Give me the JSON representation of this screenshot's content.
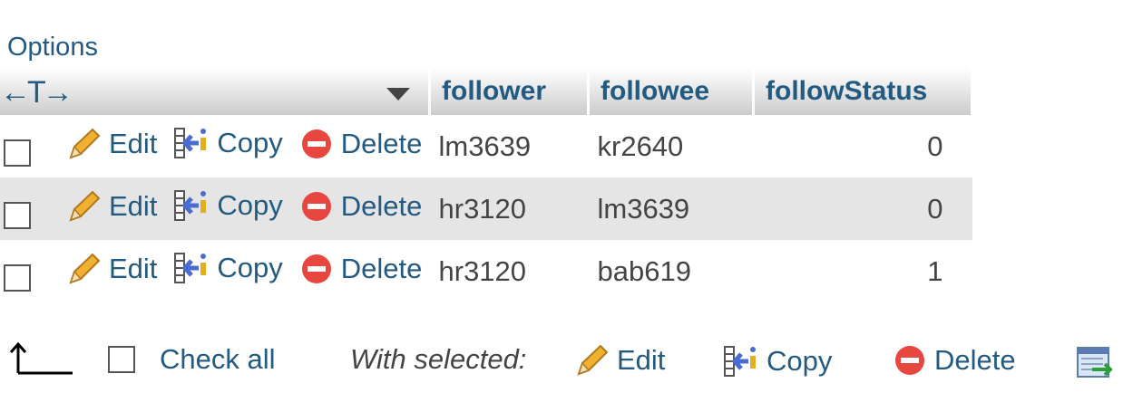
{
  "options_label": "Options",
  "header": {
    "arrows": "←T→",
    "columns": [
      "follower",
      "followee",
      "followStatus"
    ]
  },
  "row_actions": {
    "edit": "Edit",
    "copy": "Copy",
    "delete": "Delete"
  },
  "rows": [
    {
      "follower": "lm3639",
      "followee": "kr2640",
      "followStatus": "0"
    },
    {
      "follower": "hr3120",
      "followee": "lm3639",
      "followStatus": "0"
    },
    {
      "follower": "hr3120",
      "followee": "bab619",
      "followStatus": "1"
    }
  ],
  "footer": {
    "check_all": "Check all",
    "with_selected": "With selected:",
    "edit": "Edit",
    "copy": "Copy",
    "delete": "Delete"
  },
  "colors": {
    "link": "#235a81",
    "row_alt": "#e5e5e5",
    "delete_red": "#e8473f",
    "pencil": "#f0b030"
  },
  "icons": [
    "pencil-icon",
    "copy-icon",
    "delete-icon",
    "export-icon",
    "select-arrow-icon",
    "sort-triangle-icon"
  ]
}
